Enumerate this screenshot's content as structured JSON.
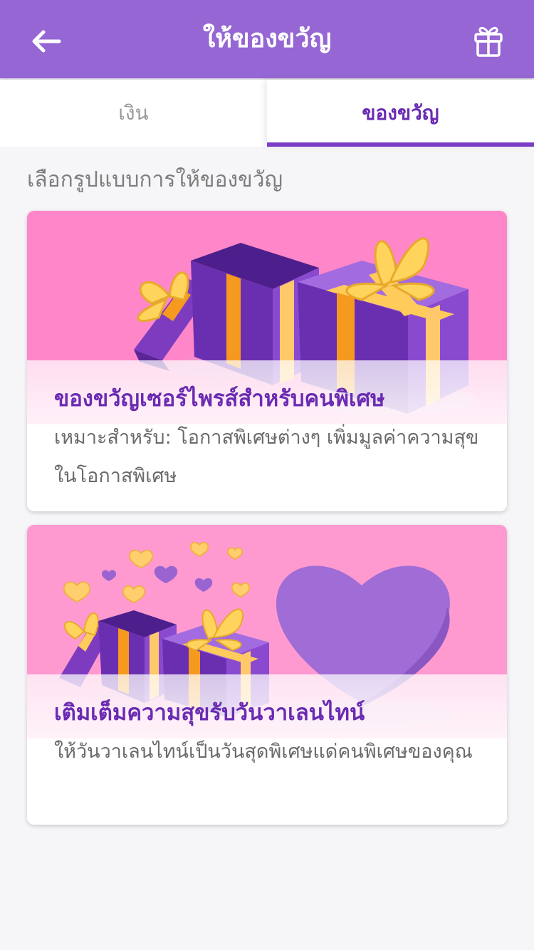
{
  "header": {
    "title": "ให้ของขวัญ",
    "back_icon": "arrow-left-icon",
    "gift_icon": "gift-box-icon"
  },
  "tabs": [
    {
      "label": "เงิน",
      "active": false
    },
    {
      "label": "ของขวัญ",
      "active": true
    }
  ],
  "section_label": "เลือกรูปแบบการให้ของขวัญ",
  "cards": [
    {
      "title": "ของขวัญเซอร์ไพรส์สำหรับคนพิเศษ",
      "description": "เหมาะสำหรับ: โอกาสพิเศษต่างๆ เพิ่มมูลค่าความสุขในโอกาสพิเศษ",
      "art": "gift-boxes-illustration"
    },
    {
      "title": "เติมเต็มความสุขรับวันวาเลนไทน์",
      "description": "ให้วันวาเลนไทน์เป็นวันสุดพิเศษแด่คนพิเศษของคุณ",
      "art": "valentine-heart-gifts-illustration"
    }
  ],
  "colors": {
    "header_bg": "#9566d4",
    "accent": "#6a2bb2",
    "card_art_bg": "#ff86c8"
  }
}
